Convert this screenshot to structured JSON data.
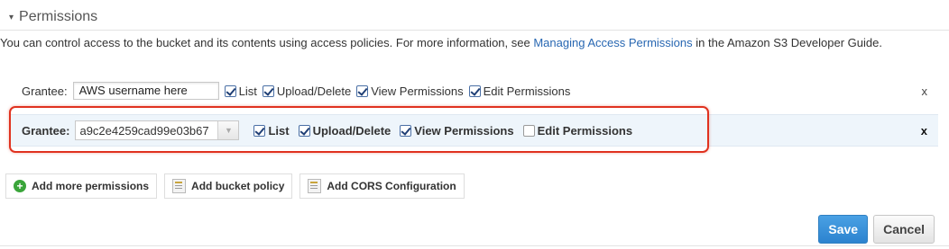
{
  "section": {
    "title": "Permissions",
    "caret": "▾"
  },
  "description": {
    "before_link": "You can control access to the bucket and its contents using access policies. For more information, see ",
    "link_text": "Managing Access Permissions",
    "after_link": " in the Amazon S3 Developer Guide."
  },
  "grantees": [
    {
      "label": "Grantee:",
      "input_value": "AWS username here",
      "permissions": [
        {
          "label": "List",
          "checked": true
        },
        {
          "label": "Upload/Delete",
          "checked": true
        },
        {
          "label": "View Permissions",
          "checked": true
        },
        {
          "label": "Edit Permissions",
          "checked": true
        }
      ],
      "remove": "x"
    },
    {
      "label": "Grantee:",
      "select_value": "a9c2e4259cad99e03b67",
      "permissions": [
        {
          "label": "List",
          "checked": true
        },
        {
          "label": "Upload/Delete",
          "checked": true
        },
        {
          "label": "View Permissions",
          "checked": true
        },
        {
          "label": "Edit Permissions",
          "checked": false
        }
      ],
      "remove": "x"
    }
  ],
  "actions": {
    "add_permissions": "Add more permissions",
    "add_bucket_policy": "Add bucket policy",
    "add_cors": "Add CORS Configuration"
  },
  "buttons": {
    "save": "Save",
    "cancel": "Cancel"
  },
  "colors": {
    "link": "#2867b2",
    "highlight": "#e0321f",
    "selected_row_bg": "#eef5fb",
    "save_bg": "#2c83cf"
  }
}
